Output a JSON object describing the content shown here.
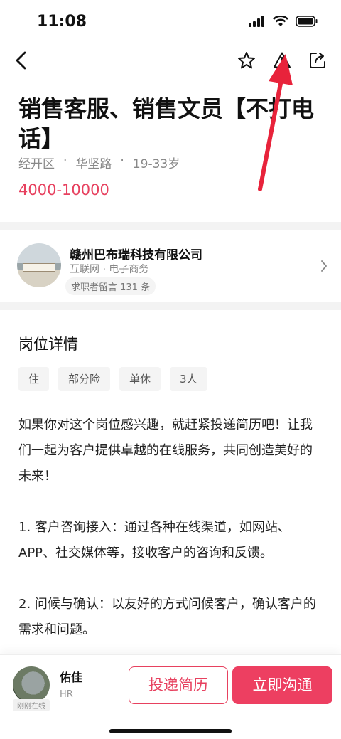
{
  "status_bar": {
    "time": "11:08"
  },
  "job": {
    "title": "销售客服、销售文员【不打电话】",
    "location": "经开区",
    "road": "华坚路",
    "age": "19-33岁",
    "separator": "·",
    "salary": "4000-10000"
  },
  "company": {
    "name": "赣州巴布瑞科技有限公司",
    "industry": "互联网 · 电子商务",
    "messages": "求职者留言 131 条"
  },
  "details": {
    "section_title": "岗位详情",
    "tags": [
      "住",
      "部分险",
      "单休",
      "3人"
    ],
    "description": "如果你对这个岗位感兴趣，就赶紧投递简历吧！让我们一起为客户提供卓越的在线服务，共同创造美好的未来！\n\n1. 客户咨询接入：通过各种在线渠道，如网站、APP、社交媒体等，接收客户的咨询和反馈。\n\n2. 问候与确认：以友好的方式问候客户，确认客户的需求和问题。"
  },
  "hr": {
    "name": "佑佳",
    "role": "HR",
    "online": "刚刚在线"
  },
  "actions": {
    "resume": "投递简历",
    "chat": "立即沟通"
  },
  "colors": {
    "accent": "#e7415f",
    "annotation": "#e8233b"
  },
  "icons": [
    "back-icon",
    "star-icon",
    "warning-icon",
    "share-icon",
    "chevron-right-icon"
  ]
}
